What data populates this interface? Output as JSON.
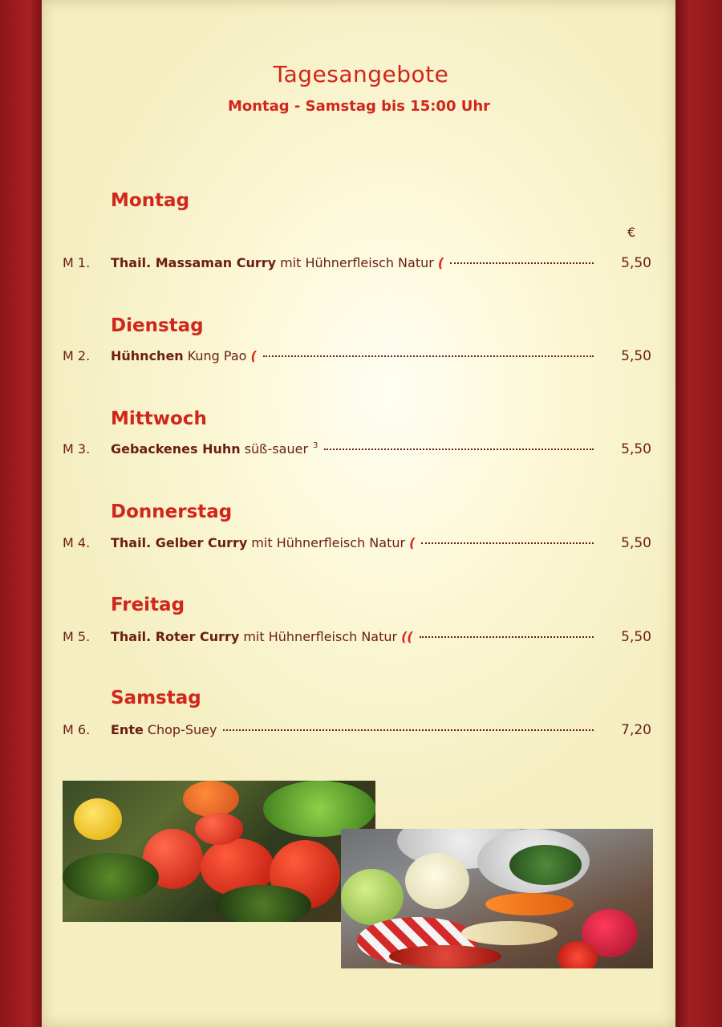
{
  "header": {
    "title": "Tagesangebote",
    "subtitle": "Montag - Samstag bis 15:00 Uhr"
  },
  "currency_symbol": "€",
  "days": [
    {
      "day": "Montag",
      "item": {
        "code": "M 1.",
        "name": "Thail. Massaman Curry",
        "desc": "mit Hühnerfleisch Natur",
        "spicy": 1,
        "price": "5,50"
      }
    },
    {
      "day": "Dienstag",
      "item": {
        "code": "M 2.",
        "name": "Hühnchen",
        "desc": "Kung Pao",
        "spicy": 1,
        "price": "5,50"
      }
    },
    {
      "day": "Mittwoch",
      "item": {
        "code": "M 3.",
        "name": "Gebackenes Huhn",
        "desc": "süß-sauer",
        "note": "3",
        "spicy": 0,
        "price": "5,50"
      }
    },
    {
      "day": "Donnerstag",
      "item": {
        "code": "M 4.",
        "name": "Thail. Gelber Curry",
        "desc": "mit Hühnerfleisch Natur",
        "spicy": 1,
        "price": "5,50"
      }
    },
    {
      "day": "Freitag",
      "item": {
        "code": "M 5.",
        "name": "Thail. Roter Curry",
        "desc": "mit Hühnerfleisch Natur",
        "spicy": 2,
        "price": "5,50"
      }
    },
    {
      "day": "Samstag",
      "item": {
        "code": "M 6.",
        "name": "Ente",
        "desc": "Chop-Suey",
        "spicy": 0,
        "price": "7,20"
      }
    }
  ],
  "icons": {
    "chili": "chili-pepper-icon"
  },
  "colors": {
    "accent_red": "#d0261c",
    "text_brown": "#6b1d12",
    "border_red": "#9e1c1f",
    "paper": "#fcf8d8"
  }
}
